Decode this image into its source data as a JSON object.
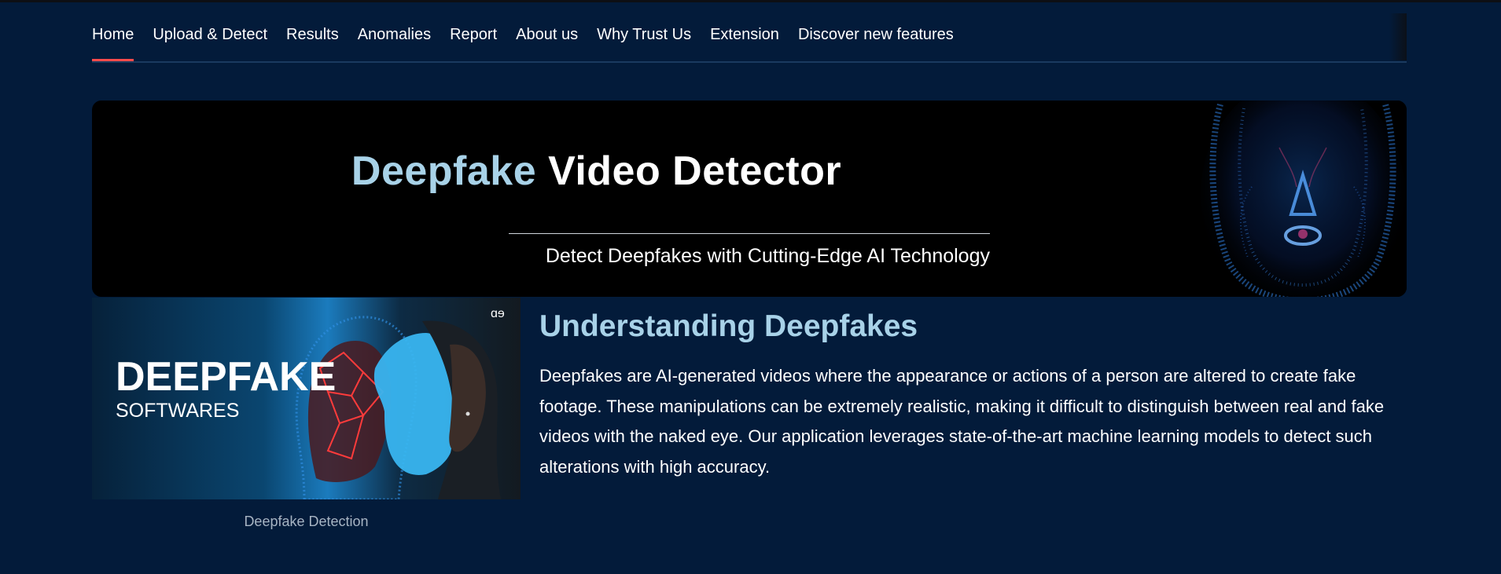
{
  "nav": {
    "tabs": [
      {
        "label": "Home",
        "active": true
      },
      {
        "label": "Upload & Detect",
        "active": false
      },
      {
        "label": "Results",
        "active": false
      },
      {
        "label": "Anomalies",
        "active": false
      },
      {
        "label": "Report",
        "active": false
      },
      {
        "label": "About us",
        "active": false
      },
      {
        "label": "Why Trust Us",
        "active": false
      },
      {
        "label": "Extension",
        "active": false
      },
      {
        "label": "Discover new features",
        "active": false
      }
    ],
    "active_indicator_color": "#ff4b4b"
  },
  "hero": {
    "title_accent": "Deepfake",
    "title_rest": "Video Detector",
    "subtitle": "Detect Deepfakes with Cutting-Edge AI Technology",
    "accent_color": "#a8d2e8"
  },
  "feature": {
    "image": {
      "headline": "DEEPFAKE",
      "subheadline": "SOFTWARES",
      "logo_icon": "gfg-logo-icon"
    },
    "caption": "Deepfake Detection",
    "title": "Understanding Deepfakes",
    "body": "Deepfakes are AI-generated videos where the appearance or actions of a person are altered to create fake footage. These manipulations can be extremely realistic, making it difficult to distinguish between real and fake videos with the naked eye. Our application leverages state-of-the-art machine learning models to detect such alterations with high accuracy."
  },
  "colors": {
    "background": "#031b3a",
    "hero_background": "#000000"
  }
}
